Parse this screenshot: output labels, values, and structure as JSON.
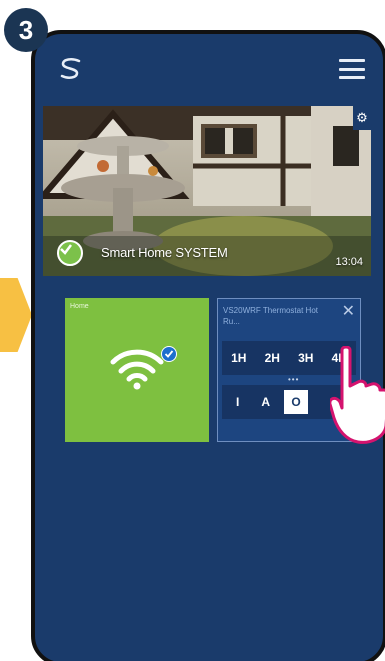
{
  "step": {
    "number": "3"
  },
  "app": {
    "logo_icon": "syxthsense-logo-icon",
    "menu_icon": "hamburger-menu-icon"
  },
  "camera": {
    "title": "Smart Home SYSTEM",
    "time": "13:04",
    "settings_icon": "gear-icon",
    "status_icon": "check-icon"
  },
  "tiles": {
    "home": {
      "label": "Home",
      "icon": "wifi-icon",
      "status_icon": "check-icon"
    },
    "thermostat": {
      "title": "VS20WRF Thermostat Hot Ru...",
      "close_icon": "close-icon",
      "hours": [
        "1H",
        "2H",
        "3H",
        "4H"
      ],
      "modes": [
        "I",
        "A",
        "O"
      ],
      "page_dots": "•••"
    }
  },
  "colors": {
    "badge": "#1b3553",
    "arrow": "#f7c043",
    "background": "#1a3b6b",
    "home_tile": "#7ec040",
    "thermo_tile": "#1d4580",
    "hand_outline": "#d4136e"
  }
}
